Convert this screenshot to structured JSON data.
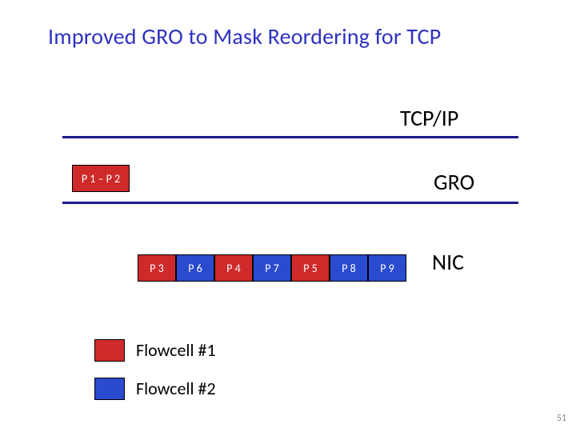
{
  "title": "Improved GRO to Mask Reordering for TCP",
  "layers": {
    "tcpip": "TCP/IP",
    "gro": "GRO",
    "nic": "NIC"
  },
  "gro_row": {
    "merged": "P 1 – P 2"
  },
  "nic_row": {
    "p3": "P 3",
    "p6": "P 6",
    "p4": "P 4",
    "p7": "P 7",
    "p5": "P 5",
    "p8": "P 8",
    "p9": "P 9"
  },
  "legend": {
    "flow1": "Flowcell #1",
    "flow2": "Flowcell #2"
  },
  "colors": {
    "red": "#cf2a2a",
    "blue": "#2a4bcf",
    "accent_line": "#1a1a8a",
    "title": "#2e31c1"
  },
  "page_number": "51"
}
